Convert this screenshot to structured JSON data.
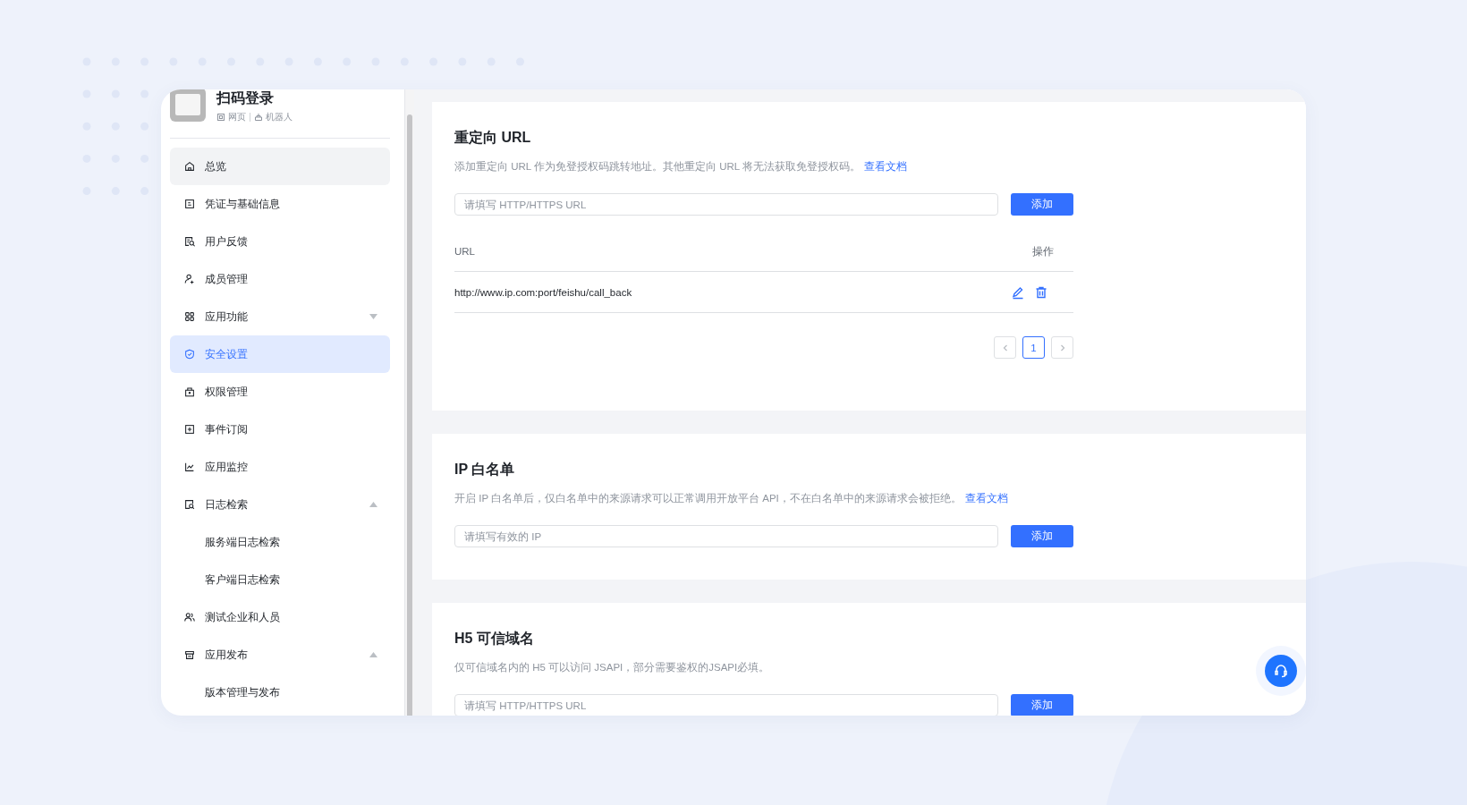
{
  "app": {
    "name": "扫码登录",
    "tags": [
      "网页",
      "机器人"
    ]
  },
  "sidebar": {
    "items": [
      {
        "kind": "item",
        "label": "总览",
        "selected": false,
        "hover": true
      },
      {
        "kind": "item",
        "label": "凭证与基础信息",
        "selected": false
      },
      {
        "kind": "item",
        "label": "用户反馈",
        "selected": false
      },
      {
        "kind": "item",
        "label": "成员管理",
        "selected": false
      },
      {
        "kind": "group",
        "label": "应用功能",
        "selected": false,
        "expanded": false
      },
      {
        "kind": "item",
        "label": "安全设置",
        "selected": true
      },
      {
        "kind": "item",
        "label": "权限管理",
        "selected": false
      },
      {
        "kind": "item",
        "label": "事件订阅",
        "selected": false
      },
      {
        "kind": "item",
        "label": "应用监控",
        "selected": false
      },
      {
        "kind": "group",
        "label": "日志检索",
        "selected": false,
        "expanded": true,
        "children": [
          {
            "label": "服务端日志检索",
            "selected": false
          },
          {
            "label": "客户端日志检索",
            "selected": false
          }
        ]
      },
      {
        "kind": "item",
        "label": "测试企业和人员",
        "selected": false
      },
      {
        "kind": "group",
        "label": "应用发布",
        "selected": false,
        "expanded": true,
        "children": [
          {
            "label": "版本管理与发布",
            "selected": false
          }
        ]
      }
    ]
  },
  "sections": [
    {
      "title": "重定向 URL",
      "description": "添加重定向 URL 作为免登授权码跳转地址。其他重定向 URL 将无法获取免登授权码。",
      "link": "查看文档",
      "placeholder": "请填写 HTTP/HTTPS URL",
      "button": "添加",
      "table": {
        "columns": [
          "URL",
          "操作"
        ],
        "rows": [
          {
            "url": "http://www.ip.com:port/feishu/call_back"
          }
        ],
        "pages": [
          {
            "label": "1",
            "selected": true
          }
        ]
      }
    },
    {
      "title": "IP 白名单",
      "description": "开启 IP 白名单后，仅白名单中的来源请求可以正常调用开放平台 API，不在白名单中的来源请求会被拒绝。",
      "link": "查看文档",
      "placeholder": "请填写有效的 IP",
      "button": "添加"
    },
    {
      "title": "H5 可信域名",
      "description": "仅可信域名内的 H5 可以访问 JSAPI，部分需要鉴权的JSAPI必填。",
      "placeholder": "请填写 HTTP/HTTPS URL",
      "button": "添加"
    }
  ]
}
